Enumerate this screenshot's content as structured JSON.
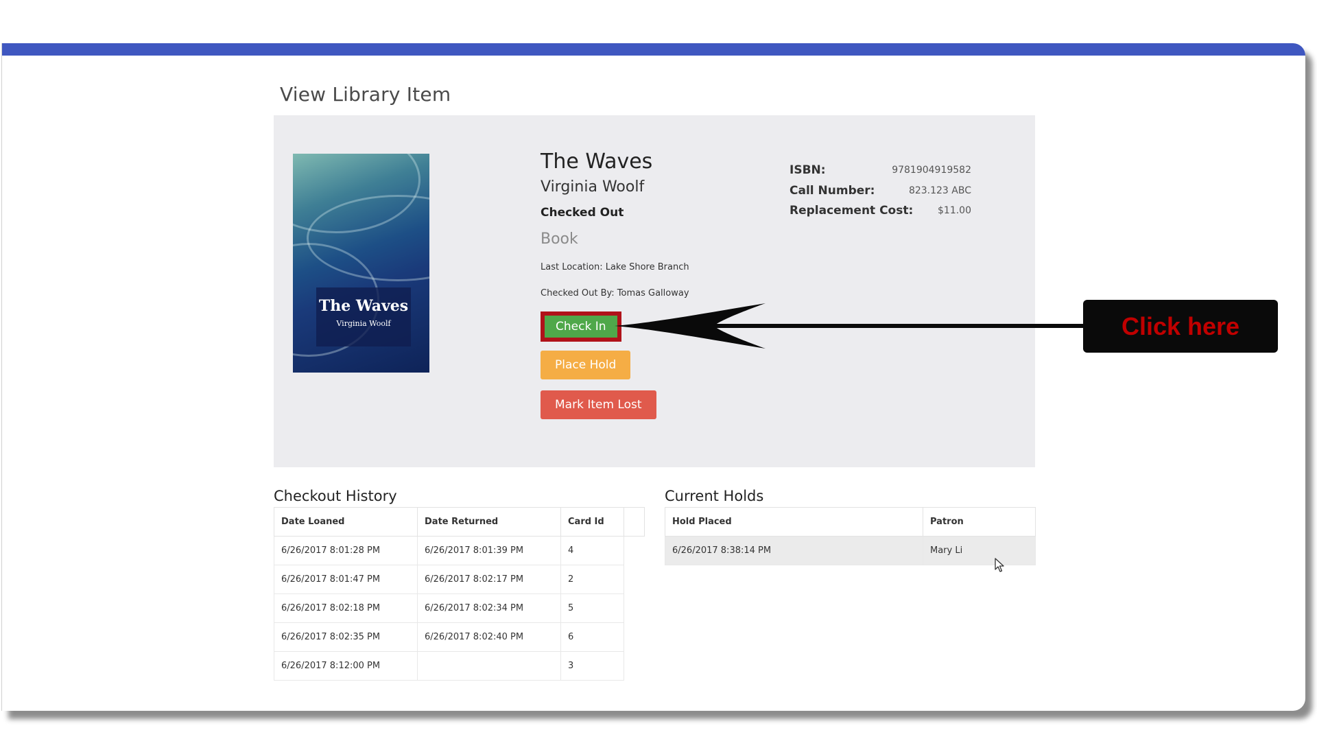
{
  "page": {
    "title": "View Library Item"
  },
  "cover": {
    "title": "The Waves",
    "author": "Virginia Woolf"
  },
  "item": {
    "title": "The Waves",
    "author": "Virginia Woolf",
    "status": "Checked Out",
    "type": "Book",
    "location": "Last Location: Lake Shore Branch",
    "checked_out_by": "Checked Out By: Tomas Galloway"
  },
  "meta": {
    "isbn_label": "ISBN:",
    "isbn": "9781904919582",
    "call_label": "Call Number:",
    "call": "823.123 ABC",
    "cost_label": "Replacement Cost:",
    "cost": "$11.00"
  },
  "actions": {
    "check_in": "Check In",
    "place_hold": "Place Hold",
    "mark_lost": "Mark Item Lost"
  },
  "annotation": {
    "text": "Click here",
    "color": "#c00000"
  },
  "history": {
    "title": "Checkout History",
    "columns": [
      "Date Loaned",
      "Date Returned",
      "Card Id"
    ],
    "rows": [
      [
        "6/26/2017 8:01:28 PM",
        "6/26/2017 8:01:39 PM",
        "4"
      ],
      [
        "6/26/2017 8:01:47 PM",
        "6/26/2017 8:02:17 PM",
        "2"
      ],
      [
        "6/26/2017 8:02:18 PM",
        "6/26/2017 8:02:34 PM",
        "5"
      ],
      [
        "6/26/2017 8:02:35 PM",
        "6/26/2017 8:02:40 PM",
        "6"
      ],
      [
        "6/26/2017 8:12:00 PM",
        "",
        "3"
      ]
    ]
  },
  "holds": {
    "title": "Current Holds",
    "columns": [
      "Hold Placed",
      "Patron"
    ],
    "rows": [
      [
        "6/26/2017 8:38:14 PM",
        "Mary Li"
      ]
    ]
  },
  "colors": {
    "accent_bar": "#3f57c0",
    "check_in": "#4fa84a",
    "place_hold": "#f5ad45",
    "mark_lost": "#e05a4c",
    "highlight_border": "#b0121a"
  }
}
